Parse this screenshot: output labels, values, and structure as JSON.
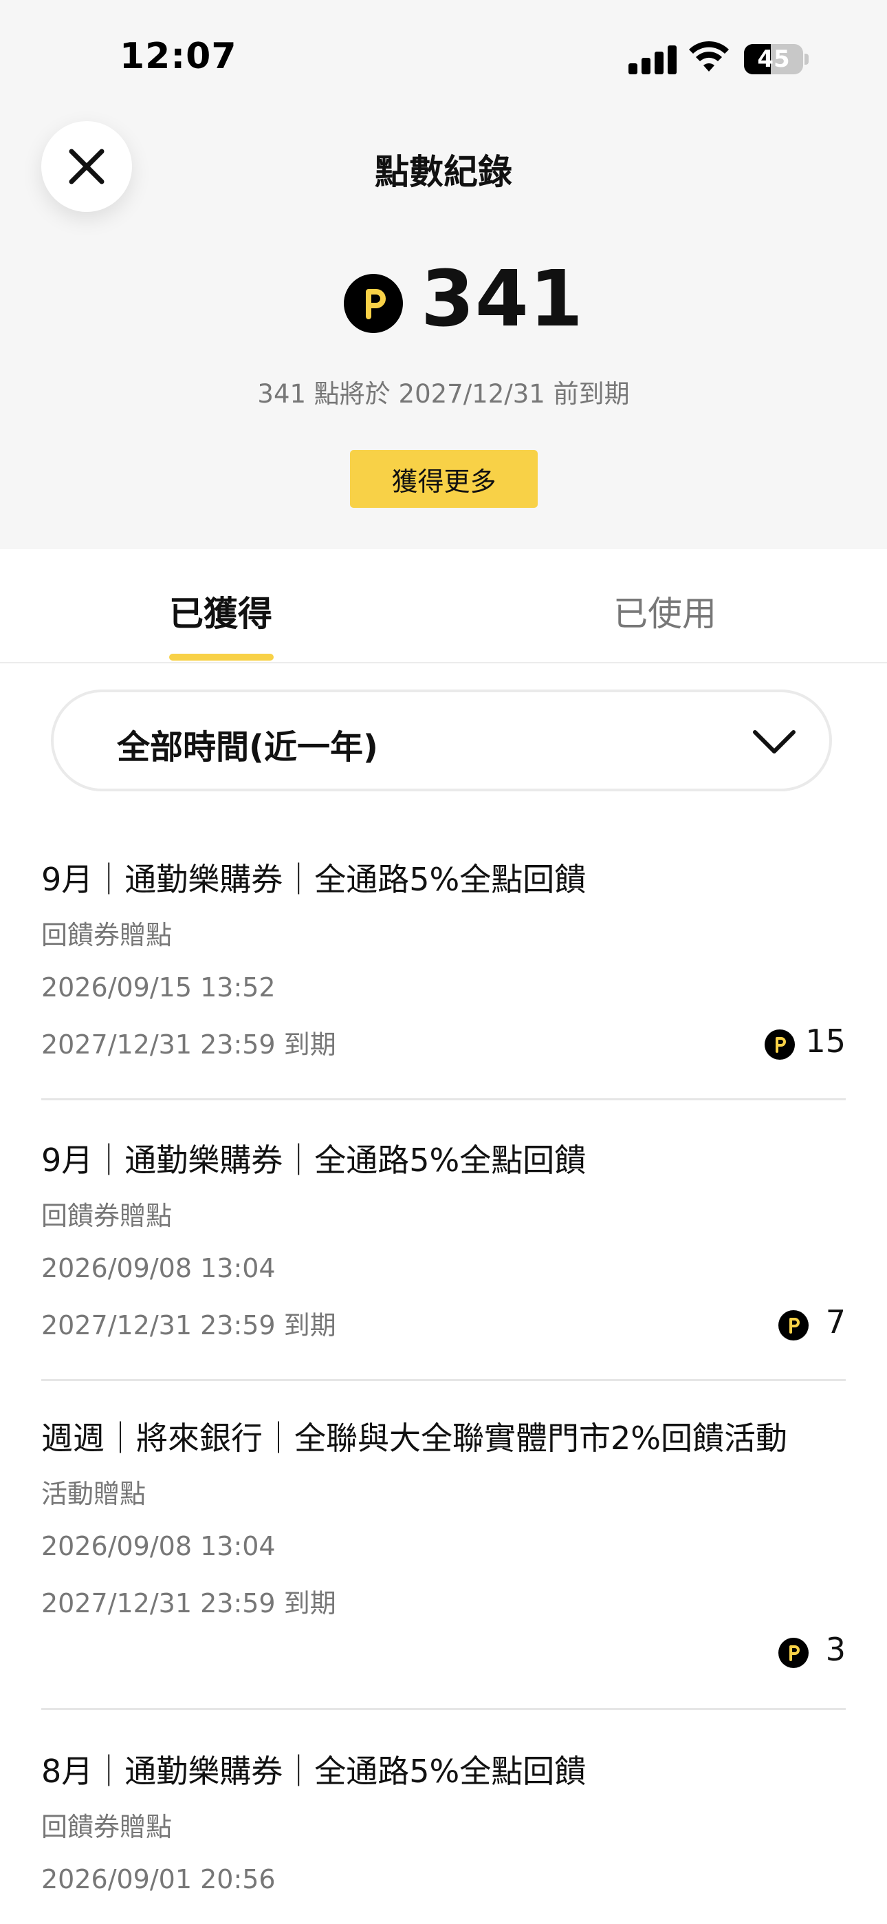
{
  "status_bar": {
    "time": "12:07",
    "battery": "45"
  },
  "header": {
    "title": "點數紀錄"
  },
  "balance": {
    "points": "341",
    "expire_note": "341 點將於 2027/12/31 前到期",
    "earn_more_label": "獲得更多"
  },
  "tabs": [
    {
      "label": "已獲得",
      "active": true
    },
    {
      "label": "已使用",
      "active": false
    }
  ],
  "filter": {
    "selected": "全部時間(近一年)"
  },
  "records": [
    {
      "title": "9月｜通勤樂購券｜全通路5%全點回饋",
      "type": "回饋券贈點",
      "date": "2026/09/15 13:52",
      "expiry": "2027/12/31 23:59 到期",
      "amount": "15"
    },
    {
      "title": "9月｜通勤樂購券｜全通路5%全點回饋",
      "type": "回饋券贈點",
      "date": "2026/09/08 13:04",
      "expiry": "2027/12/31 23:59 到期",
      "amount": "7"
    },
    {
      "title": "週週｜將來銀行｜全聯與大全聯實體門市2%回饋活動",
      "type": "活動贈點",
      "date": "2026/09/08 13:04",
      "expiry": "2027/12/31 23:59 到期",
      "amount": "3"
    },
    {
      "title": "8月｜通勤樂購券｜全通路5%全點回饋",
      "type": "回饋券贈點",
      "date": "2026/09/01 20:56",
      "expiry": "",
      "amount": ""
    }
  ],
  "colors": {
    "accent": "#f8d147",
    "coin_bg": "#000000",
    "muted_text": "#777777",
    "header_bg": "#f6f6f6"
  }
}
